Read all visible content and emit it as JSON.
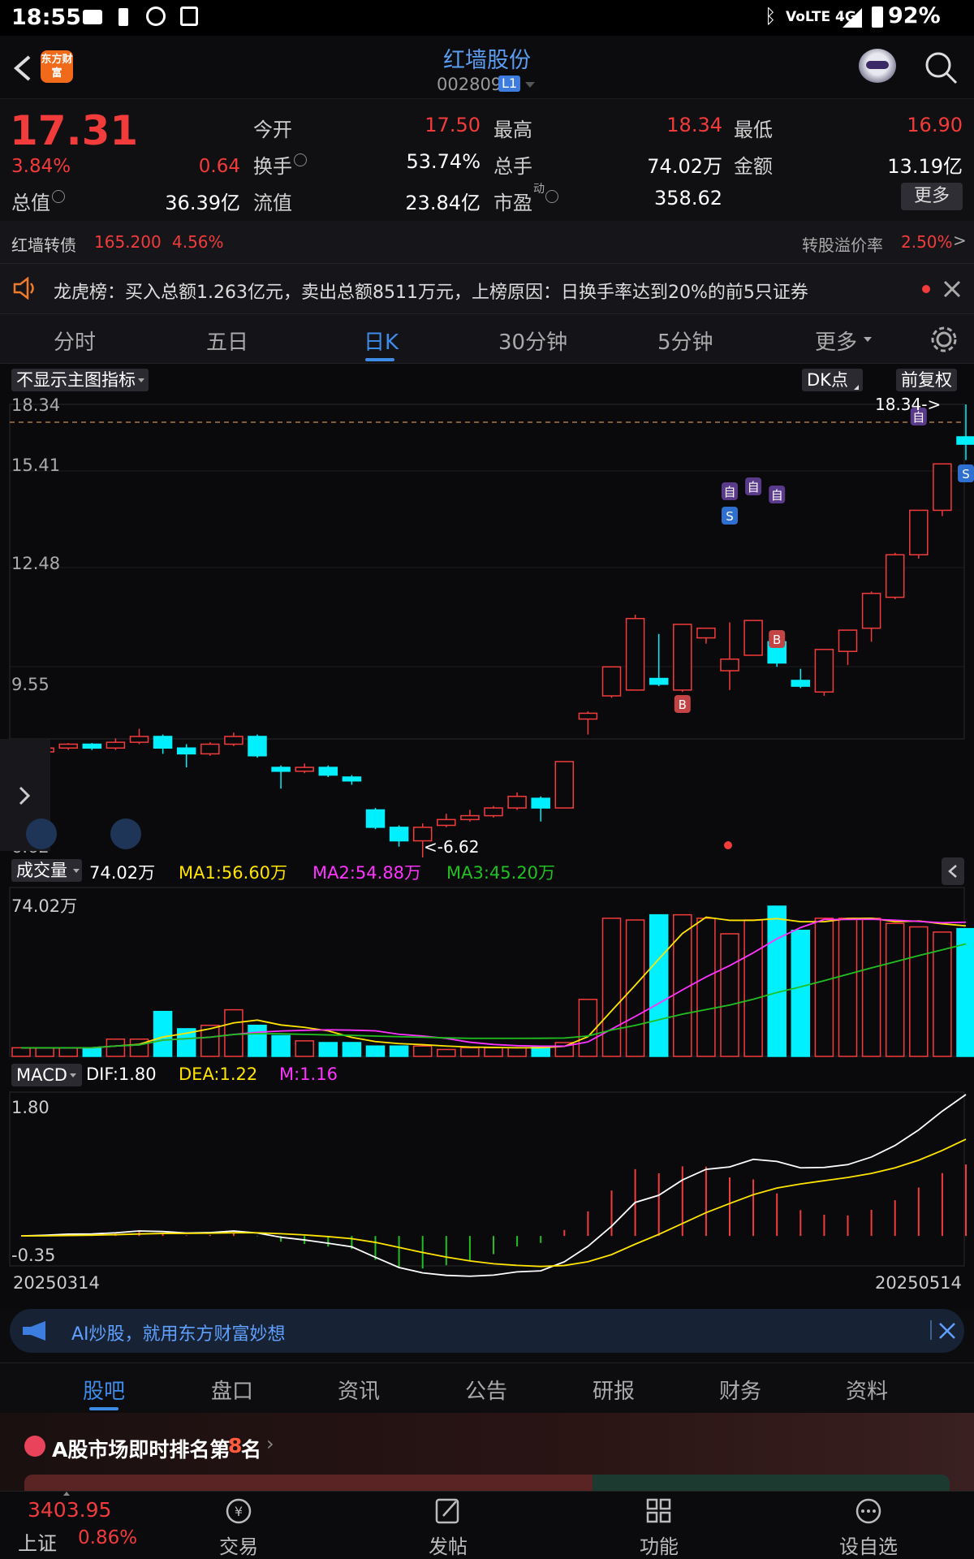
{
  "status": {
    "time": "18:55",
    "network": "VoLTE 4G",
    "battery": "92%"
  },
  "header": {
    "logo_text": "东方财富",
    "stock_name": "红墙股份",
    "stock_code": "002809",
    "level_badge": "L1"
  },
  "quote": {
    "price": "17.31",
    "change_pct": "3.84%",
    "change_amt": "0.64",
    "fields": {
      "open_label": "今开",
      "open_value": "17.50",
      "high_label": "最高",
      "high_value": "18.34",
      "low_label": "最低",
      "low_value": "16.90",
      "turnover_label": "换手",
      "turnover_value": "53.74%",
      "volume_label": "总手",
      "volume_value": "74.02万",
      "amount_label": "金额",
      "amount_value": "13.19亿",
      "total_value_label": "总值",
      "total_value_value": "36.39亿",
      "float_value_label": "流值",
      "float_value_value": "23.84亿",
      "pe_label": "市盈",
      "pe_sup": "动",
      "pe_value": "358.62"
    },
    "more_button": "更多"
  },
  "bond": {
    "name": "红墙转债",
    "price": "165.200",
    "pct": "4.56%",
    "premium_label": "转股溢价率",
    "premium_value": "2.50%",
    "arrow": ">"
  },
  "notice": {
    "text": "龙虎榜：买入总额1.263亿元，卖出总额8511万元，上榜原因：日换手率达到20%的前5只证券"
  },
  "tabs": [
    {
      "label": "分时"
    },
    {
      "label": "五日"
    },
    {
      "label": "日K"
    },
    {
      "label": "30分钟"
    },
    {
      "label": "5分钟"
    },
    {
      "label": "更多"
    }
  ],
  "chart_controls": {
    "indicator_button": "不显示主图指标",
    "dk_button": "DK点",
    "adjust_button": "前复权"
  },
  "chart_data": [
    {
      "type": "candlestick",
      "y_ticks": [
        "18.34",
        "15.41",
        "12.48",
        "9.55",
        "6.62"
      ],
      "ylim": [
        6.62,
        18.34
      ],
      "max_annotation": "18.34->",
      "min_annotation": "<-6.62",
      "marker_labels": [
        "自",
        "自",
        "自",
        "自",
        "S",
        "S",
        "B",
        "B"
      ],
      "candles": [
        [
          9.25,
          9.35,
          9.2,
          9.4
        ],
        [
          9.35,
          9.45,
          9.3,
          9.5
        ],
        [
          9.45,
          9.55,
          9.4,
          9.58
        ],
        [
          9.55,
          9.45,
          9.4,
          9.58
        ],
        [
          9.45,
          9.6,
          9.4,
          9.7
        ],
        [
          9.6,
          9.75,
          9.55,
          9.95
        ],
        [
          9.75,
          9.45,
          9.3,
          9.8
        ],
        [
          9.45,
          9.3,
          8.95,
          9.55
        ],
        [
          9.3,
          9.55,
          9.25,
          9.6
        ],
        [
          9.55,
          9.75,
          9.5,
          9.85
        ],
        [
          9.75,
          9.25,
          9.2,
          9.8
        ],
        [
          8.95,
          8.85,
          8.4,
          9.0
        ],
        [
          8.85,
          8.95,
          8.8,
          9.05
        ],
        [
          8.95,
          8.75,
          8.7,
          9.0
        ],
        [
          8.7,
          8.6,
          8.5,
          8.75
        ],
        [
          7.85,
          7.4,
          7.35,
          7.9
        ],
        [
          7.4,
          7.05,
          6.9,
          7.45
        ],
        [
          7.05,
          7.4,
          6.62,
          7.5
        ],
        [
          7.45,
          7.6,
          7.4,
          7.75
        ],
        [
          7.6,
          7.7,
          7.55,
          7.85
        ],
        [
          7.7,
          7.9,
          7.65,
          7.95
        ],
        [
          7.9,
          8.2,
          7.85,
          8.3
        ],
        [
          8.15,
          7.9,
          7.55,
          8.2
        ],
        [
          7.9,
          9.1,
          7.9,
          9.1
        ],
        [
          10.2,
          10.35,
          9.8,
          10.4
        ],
        [
          10.8,
          11.55,
          10.75,
          11.55
        ],
        [
          10.95,
          12.8,
          10.95,
          12.9
        ],
        [
          11.25,
          11.1,
          11.05,
          12.4
        ],
        [
          10.95,
          12.65,
          10.9,
          12.65
        ],
        [
          12.3,
          12.55,
          12.15,
          12.55
        ],
        [
          11.45,
          11.75,
          10.95,
          12.7
        ],
        [
          11.85,
          12.75,
          11.85,
          12.75
        ],
        [
          12.2,
          11.65,
          11.55,
          12.2
        ],
        [
          11.2,
          11.05,
          11.0,
          11.5
        ],
        [
          10.9,
          12.0,
          10.8,
          12.0
        ],
        [
          11.95,
          12.5,
          11.6,
          12.5
        ],
        [
          12.55,
          13.45,
          12.2,
          13.5
        ],
        [
          13.35,
          14.45,
          13.3,
          14.5
        ],
        [
          14.45,
          15.6,
          14.35,
          15.6
        ],
        [
          15.6,
          16.8,
          15.45,
          16.8
        ],
        [
          17.5,
          17.31,
          16.9,
          18.34
        ]
      ]
    },
    {
      "type": "bar",
      "name": "成交量",
      "title": "成交量",
      "current": "74.02万",
      "ma1": "MA1:56.60万",
      "ma2": "MA2:54.88万",
      "ma3": "MA3:45.20万",
      "y_tick": "74.02万",
      "volumes": [
        5,
        5,
        5,
        5,
        10,
        10,
        26,
        16,
        18,
        27,
        18,
        12,
        9,
        8,
        8,
        6,
        6,
        6,
        4,
        5,
        5,
        5,
        6,
        8,
        33,
        80,
        79,
        82,
        82,
        80,
        71,
        79,
        87,
        73,
        80,
        80,
        80,
        77,
        75,
        72,
        74
      ]
    },
    {
      "type": "bar",
      "name": "MACD",
      "title": "MACD",
      "dif": "DIF:1.80",
      "dea": "DEA:1.22",
      "m": "M:1.16",
      "y_ticks": [
        "1.80",
        "-0.35"
      ],
      "ylim": [
        -0.35,
        1.8
      ],
      "start_date": "20250314",
      "end_date": "20250514"
    }
  ],
  "ai_bar": {
    "text": "AI炒股，就用东方财富妙想"
  },
  "bottom_tabs": [
    {
      "label": "股吧"
    },
    {
      "label": "盘口"
    },
    {
      "label": "资讯"
    },
    {
      "label": "公告"
    },
    {
      "label": "研报"
    },
    {
      "label": "财务"
    },
    {
      "label": "资料"
    }
  ],
  "ranking": {
    "prefix": "A股市场即时排名第",
    "rank": "8",
    "suffix": "名"
  },
  "footer": {
    "index_value": "3403.95",
    "index_name": "上证",
    "index_pct": "0.86%",
    "items": [
      {
        "label": "交易"
      },
      {
        "label": "发帖"
      },
      {
        "label": "功能"
      },
      {
        "label": "设自选"
      }
    ]
  },
  "colors": {
    "up": "#f23b3b",
    "down": "#00f0ff",
    "accent": "#3d8ce8",
    "yellow": "#ffe400",
    "magenta": "#ff33ff",
    "green": "#21c021"
  }
}
